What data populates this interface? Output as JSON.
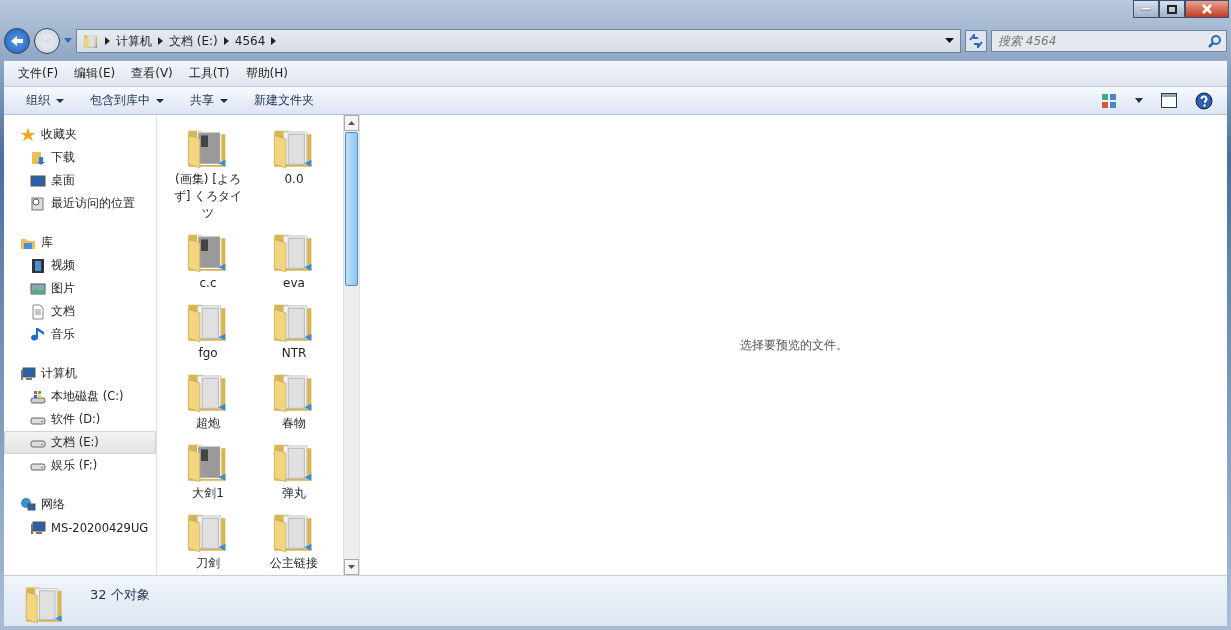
{
  "window": {
    "controls": [
      {
        "kind": "minimize"
      },
      {
        "kind": "maximize"
      },
      {
        "kind": "close"
      }
    ]
  },
  "address_bar": {
    "crumbs": [
      "计算机",
      "文档 (E:)",
      "4564"
    ]
  },
  "search": {
    "placeholder": "搜索 4564"
  },
  "menu_bar": [
    "文件(F)",
    "编辑(E)",
    "查看(V)",
    "工具(T)",
    "帮助(H)"
  ],
  "toolbar": [
    {
      "label": "组织",
      "dropdown": true
    },
    {
      "label": "包含到库中",
      "dropdown": true
    },
    {
      "label": "共享",
      "dropdown": true
    },
    {
      "label": "新建文件夹",
      "dropdown": false
    }
  ],
  "sidebar": {
    "groups": [
      {
        "label": "收藏夹",
        "kind": "star",
        "children": [
          {
            "label": "下载",
            "kind": "download",
            "selected": false
          },
          {
            "label": "桌面",
            "kind": "desktop",
            "selected": false
          },
          {
            "label": "最近访问的位置",
            "kind": "recent",
            "selected": false
          }
        ]
      },
      {
        "label": "库",
        "kind": "library",
        "children": [
          {
            "label": "视频",
            "kind": "video",
            "selected": false
          },
          {
            "label": "图片",
            "kind": "picture",
            "selected": false
          },
          {
            "label": "文档",
            "kind": "document",
            "selected": false
          },
          {
            "label": "音乐",
            "kind": "music",
            "selected": false
          }
        ]
      },
      {
        "label": "计算机",
        "kind": "computer",
        "children": [
          {
            "label": "本地磁盘 (C:)",
            "kind": "system-drive",
            "selected": false
          },
          {
            "label": "软件 (D:)",
            "kind": "drive",
            "selected": false
          },
          {
            "label": "文档 (E:)",
            "kind": "drive",
            "selected": true
          },
          {
            "label": "娱乐 (F:)",
            "kind": "drive",
            "selected": false
          }
        ]
      },
      {
        "label": "网络",
        "kind": "network",
        "children": [
          {
            "label": "MS-20200429UG",
            "kind": "computer",
            "selected": false
          }
        ]
      }
    ]
  },
  "files": [
    {
      "name": "(画集) [よろず] くろタイツ",
      "kind": "thumbnail"
    },
    {
      "name": "0.0",
      "kind": "folder"
    },
    {
      "name": "c.c",
      "kind": "thumbnail"
    },
    {
      "name": "eva",
      "kind": "folder"
    },
    {
      "name": "fgo",
      "kind": "folder"
    },
    {
      "name": "NTR",
      "kind": "folder"
    },
    {
      "name": "超炮",
      "kind": "folder"
    },
    {
      "name": "春物",
      "kind": "folder"
    },
    {
      "name": "大剑1",
      "kind": "thumbnail"
    },
    {
      "name": "弹丸",
      "kind": "folder"
    },
    {
      "name": "刀剑",
      "kind": "folder"
    },
    {
      "name": "公主链接",
      "kind": "folder"
    }
  ],
  "preview": {
    "message": "选择要预览的文件。"
  },
  "status_bar": {
    "count": "32 个对象"
  }
}
